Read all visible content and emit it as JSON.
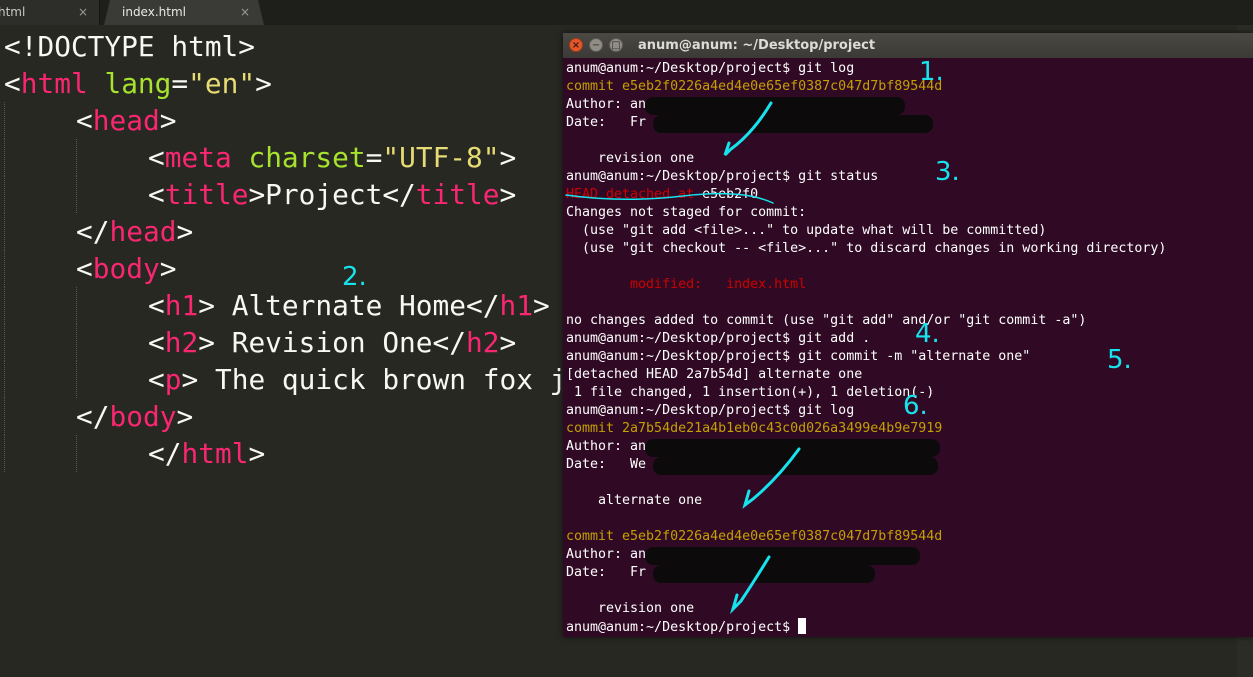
{
  "editor": {
    "tabs": [
      {
        "label": "html",
        "close": "×"
      },
      {
        "label": "index.html",
        "close": "×"
      }
    ],
    "annotation": "2.",
    "lines": [
      {
        "indent": 0,
        "tokens": [
          [
            "p",
            "<!DOCTYPE html>"
          ]
        ]
      },
      {
        "indent": 0,
        "tokens": [
          [
            "p",
            "<"
          ],
          [
            "t",
            "html"
          ],
          [
            "p",
            " "
          ],
          [
            "a",
            "lang"
          ],
          [
            "p",
            "="
          ],
          [
            "s",
            "\"en\""
          ],
          [
            "p",
            ">"
          ]
        ]
      },
      {
        "indent": 1,
        "tokens": [
          [
            "p",
            "<"
          ],
          [
            "t",
            "head"
          ],
          [
            "p",
            ">"
          ]
        ]
      },
      {
        "indent": 2,
        "tokens": [
          [
            "p",
            "<"
          ],
          [
            "t",
            "meta"
          ],
          [
            "p",
            " "
          ],
          [
            "a",
            "charset"
          ],
          [
            "p",
            "="
          ],
          [
            "s",
            "\"UTF-8\""
          ],
          [
            "p",
            ">"
          ]
        ]
      },
      {
        "indent": 2,
        "tokens": [
          [
            "p",
            "<"
          ],
          [
            "t",
            "title"
          ],
          [
            "p",
            ">Project</"
          ],
          [
            "t",
            "title"
          ],
          [
            "p",
            ">"
          ]
        ]
      },
      {
        "indent": 1,
        "tokens": [
          [
            "p",
            "</"
          ],
          [
            "t",
            "head"
          ],
          [
            "p",
            ">"
          ]
        ]
      },
      {
        "indent": 1,
        "tokens": [
          [
            "p",
            "<"
          ],
          [
            "t",
            "body"
          ],
          [
            "p",
            ">"
          ]
        ]
      },
      {
        "indent": 2,
        "tokens": [
          [
            "p",
            "<"
          ],
          [
            "t",
            "h1"
          ],
          [
            "p",
            "> Alternate Home</"
          ],
          [
            "t",
            "h1"
          ],
          [
            "p",
            ">"
          ]
        ]
      },
      {
        "indent": 2,
        "tokens": [
          [
            "p",
            "<"
          ],
          [
            "t",
            "h2"
          ],
          [
            "p",
            "> Revision One</"
          ],
          [
            "t",
            "h2"
          ],
          [
            "p",
            ">"
          ]
        ]
      },
      {
        "indent": 2,
        "tokens": [
          [
            "p",
            "<"
          ],
          [
            "t",
            "p"
          ],
          [
            "p",
            "> The quick brown fox jumps over the lazy dog</"
          ],
          [
            "t",
            "p"
          ],
          [
            "p",
            ">"
          ]
        ]
      },
      {
        "indent": 1,
        "tokens": [
          [
            "p",
            "</"
          ],
          [
            "t",
            "body"
          ],
          [
            "p",
            ">"
          ]
        ]
      },
      {
        "indent": 2,
        "tokens": [
          [
            "p",
            "</"
          ],
          [
            "t",
            "html"
          ],
          [
            "p",
            ">"
          ]
        ]
      }
    ]
  },
  "terminal": {
    "title": "anum@anum: ~/Desktop/project",
    "buttons": {
      "close": "×",
      "minimize": "−",
      "maximize": "□"
    },
    "lines": [
      [
        [
          "w",
          "anum@anum:~/Desktop/project$ git log"
        ]
      ],
      [
        [
          "y",
          "commit e5eb2f0226a4ed4e0e65ef0387c047d7bf89544d"
        ]
      ],
      [
        [
          "w",
          "Author: an"
        ]
      ],
      [
        [
          "w",
          "Date:   Fr"
        ]
      ],
      [
        [
          "w",
          ""
        ]
      ],
      [
        [
          "w",
          "    revision one"
        ]
      ],
      [
        [
          "w",
          "anum@anum:~/Desktop/project$ git status"
        ]
      ],
      [
        [
          "r",
          "HEAD detached at "
        ],
        [
          "w",
          "e5eb2f0"
        ]
      ],
      [
        [
          "w",
          "Changes not staged for commit:"
        ]
      ],
      [
        [
          "w",
          "  (use \"git add <file>...\" to update what will be committed)"
        ]
      ],
      [
        [
          "w",
          "  (use \"git checkout -- <file>...\" to discard changes in working directory)"
        ]
      ],
      [
        [
          "w",
          ""
        ]
      ],
      [
        [
          "r",
          "        modified:   index.html"
        ]
      ],
      [
        [
          "w",
          ""
        ]
      ],
      [
        [
          "w",
          "no changes added to commit (use \"git add\" and/or \"git commit -a\")"
        ]
      ],
      [
        [
          "w",
          "anum@anum:~/Desktop/project$ git add ."
        ]
      ],
      [
        [
          "w",
          "anum@anum:~/Desktop/project$ git commit -m \"alternate one\""
        ]
      ],
      [
        [
          "w",
          "[detached HEAD 2a7b54d] alternate one"
        ]
      ],
      [
        [
          "w",
          " 1 file changed, 1 insertion(+), 1 deletion(-)"
        ]
      ],
      [
        [
          "w",
          "anum@anum:~/Desktop/project$ git log"
        ]
      ],
      [
        [
          "y",
          "commit 2a7b54de21a4b1eb0c43c0d026a3499e4b9e7919"
        ]
      ],
      [
        [
          "w",
          "Author: an"
        ]
      ],
      [
        [
          "w",
          "Date:   We"
        ]
      ],
      [
        [
          "w",
          ""
        ]
      ],
      [
        [
          "w",
          "    alternate one"
        ]
      ],
      [
        [
          "w",
          ""
        ]
      ],
      [
        [
          "y",
          "commit e5eb2f0226a4ed4e0e65ef0387c047d7bf89544d"
        ]
      ],
      [
        [
          "w",
          "Author: an"
        ]
      ],
      [
        [
          "w",
          "Date:   Fr"
        ]
      ],
      [
        [
          "w",
          ""
        ]
      ],
      [
        [
          "w",
          "    revision one"
        ]
      ],
      [
        [
          "w",
          "anum@anum:~/Desktop/project$ "
        ]
      ]
    ],
    "annotations": [
      "1.",
      "3.",
      "4.",
      "5.",
      "6."
    ]
  }
}
